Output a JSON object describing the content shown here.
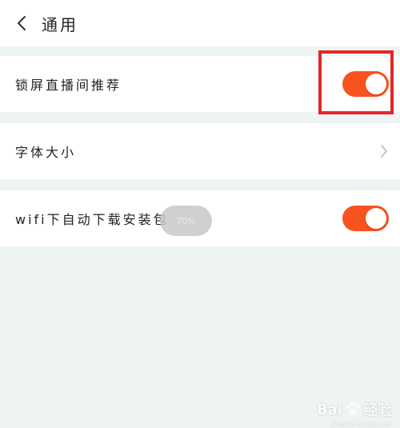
{
  "header": {
    "title": "通用",
    "back_icon": "chevron-left-icon"
  },
  "settings": {
    "lockscreen_live": {
      "label": "锁屏直播间推荐",
      "enabled": true
    },
    "font_size": {
      "label": "字体大小",
      "icon": "chevron-right-icon"
    },
    "wifi_download": {
      "label": "wifi下自动下载安装包",
      "enabled": true
    }
  },
  "progress_toast": {
    "text": "70%"
  },
  "watermark": {
    "brand_a": "Bai",
    "brand_b": "经验",
    "url": "jingyan.baidu.com"
  },
  "colors": {
    "accent": "#f8521e",
    "highlight": "#e52627",
    "background": "#eef3f3"
  }
}
